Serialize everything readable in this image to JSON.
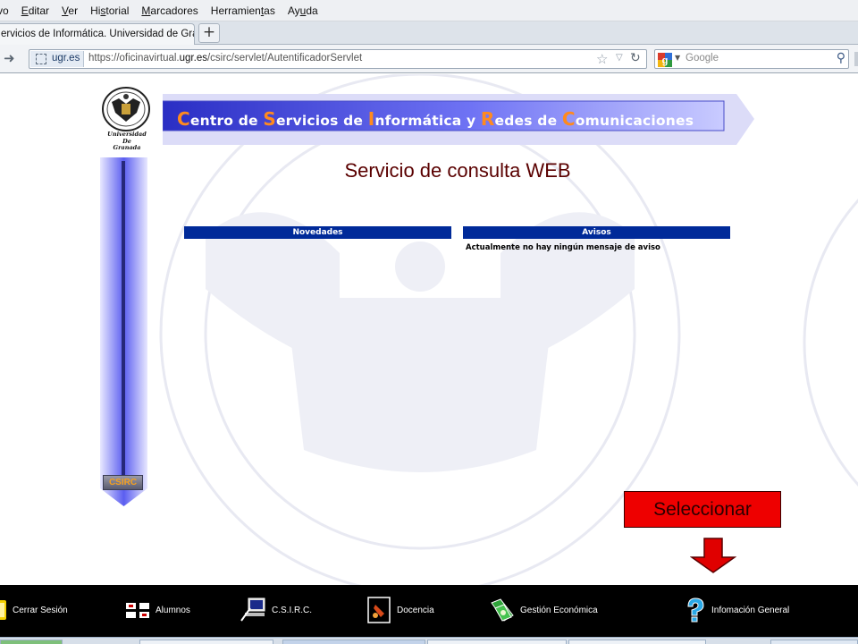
{
  "browser": {
    "menu": [
      {
        "pre": "",
        "ul": "",
        "post": "vo"
      },
      {
        "pre": "",
        "ul": "E",
        "post": "ditar"
      },
      {
        "pre": "",
        "ul": "V",
        "post": "er"
      },
      {
        "pre": "Hi",
        "ul": "s",
        "post": "torial"
      },
      {
        "pre": "",
        "ul": "M",
        "post": "arcadores"
      },
      {
        "pre": "Herramien",
        "ul": "t",
        "post": "as"
      },
      {
        "pre": "Ay",
        "ul": "u",
        "post": "da"
      }
    ],
    "tab_title": "ervicios de Informática. Universidad de Gra...",
    "new_tab_label": "+",
    "site_domain": "ugr.es",
    "url_prefix": "https://oficinavirtual.",
    "url_domain": "ugr.es",
    "url_path": "/csirc/servlet/AutentificadorServlet",
    "search_placeholder": "Google",
    "icons": {
      "back": "arrow-right-icon",
      "bookmark": "star-icon",
      "reload": "reload-icon",
      "search": "magnifier-icon"
    }
  },
  "page": {
    "university_label": [
      "Universidad",
      "De",
      "Granada"
    ],
    "sidebar_badge": "CSIRC",
    "banner": [
      {
        "cap": "C",
        "rest": "entro de "
      },
      {
        "cap": "S",
        "rest": "ervicios de "
      },
      {
        "cap": "I",
        "rest": "nformática y "
      },
      {
        "cap": "R",
        "rest": "edes de "
      },
      {
        "cap": "C",
        "rest": "omunicaciones"
      }
    ],
    "title": "Servicio de consulta WEB",
    "panels": {
      "novedades": {
        "heading": "Novedades"
      },
      "avisos": {
        "heading": "Avisos",
        "message": "Actualmente no hay ningún mensaje de aviso"
      }
    },
    "callout": "Seleccionar"
  },
  "taskbar": [
    {
      "label": "Cerrar Sesión",
      "icon": "logout-icon"
    },
    {
      "label": "Alumnos",
      "icon": "students-icon"
    },
    {
      "label": "C.S.I.R.C.",
      "icon": "computer-icon"
    },
    {
      "label": "Docencia",
      "icon": "teaching-icon"
    },
    {
      "label": "Gestión Económica",
      "icon": "money-icon"
    },
    {
      "label": "Infomación General",
      "icon": "info-icon"
    }
  ],
  "colors": {
    "panel_header": "#002a99",
    "banner_caps": "#ff8a1e",
    "title": "#5a0000",
    "callout": "#ee0000",
    "taskbar": "#000000"
  }
}
